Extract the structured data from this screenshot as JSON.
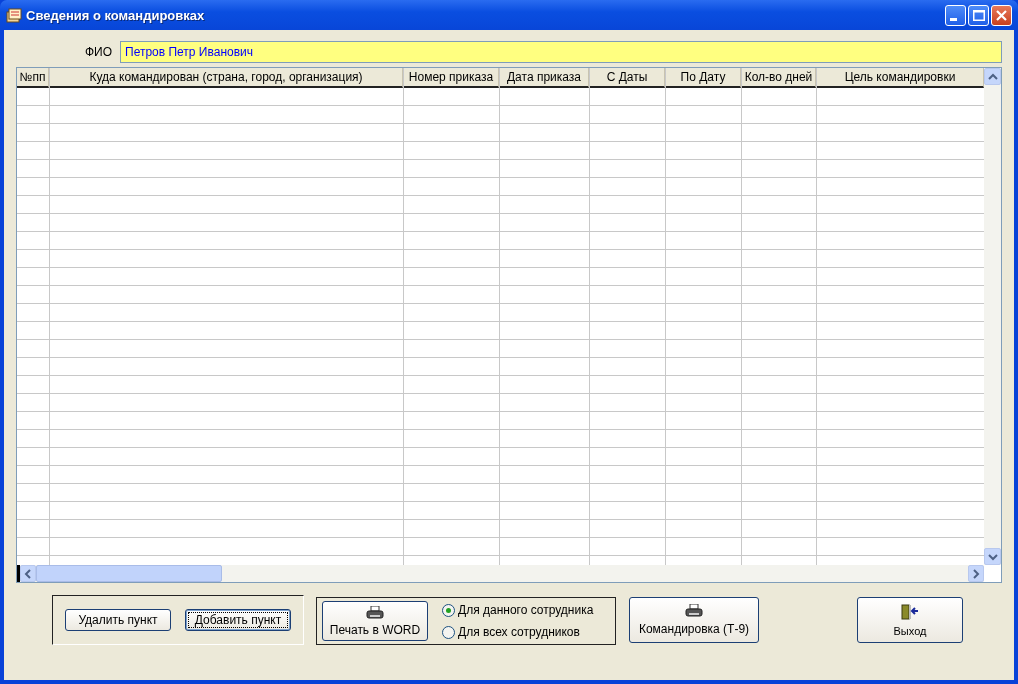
{
  "window": {
    "title": "Сведения о командировках"
  },
  "fio": {
    "label": "ФИО",
    "value": "Петров Петр Иванович"
  },
  "table": {
    "columns": [
      "№пп",
      "Куда командирован (страна, город, организация)",
      "Номер приказа",
      "Дата приказа",
      "С Даты",
      "По Дату",
      "Кол-во дней",
      "Цель командировки"
    ]
  },
  "row_buttons": [
    {
      "label": "Удалить пункт",
      "focused": false
    },
    {
      "label": "Добавить пункт",
      "focused": true
    }
  ],
  "print_button": {
    "label": "Печать в WORD"
  },
  "print_scope": [
    {
      "label": "Для данного сотрудника",
      "selected": true
    },
    {
      "label": "Для всех сотрудников",
      "selected": false
    }
  ],
  "t9_button": {
    "label": "Командировка (Т-9)"
  },
  "exit_button": {
    "label": "Выход"
  }
}
